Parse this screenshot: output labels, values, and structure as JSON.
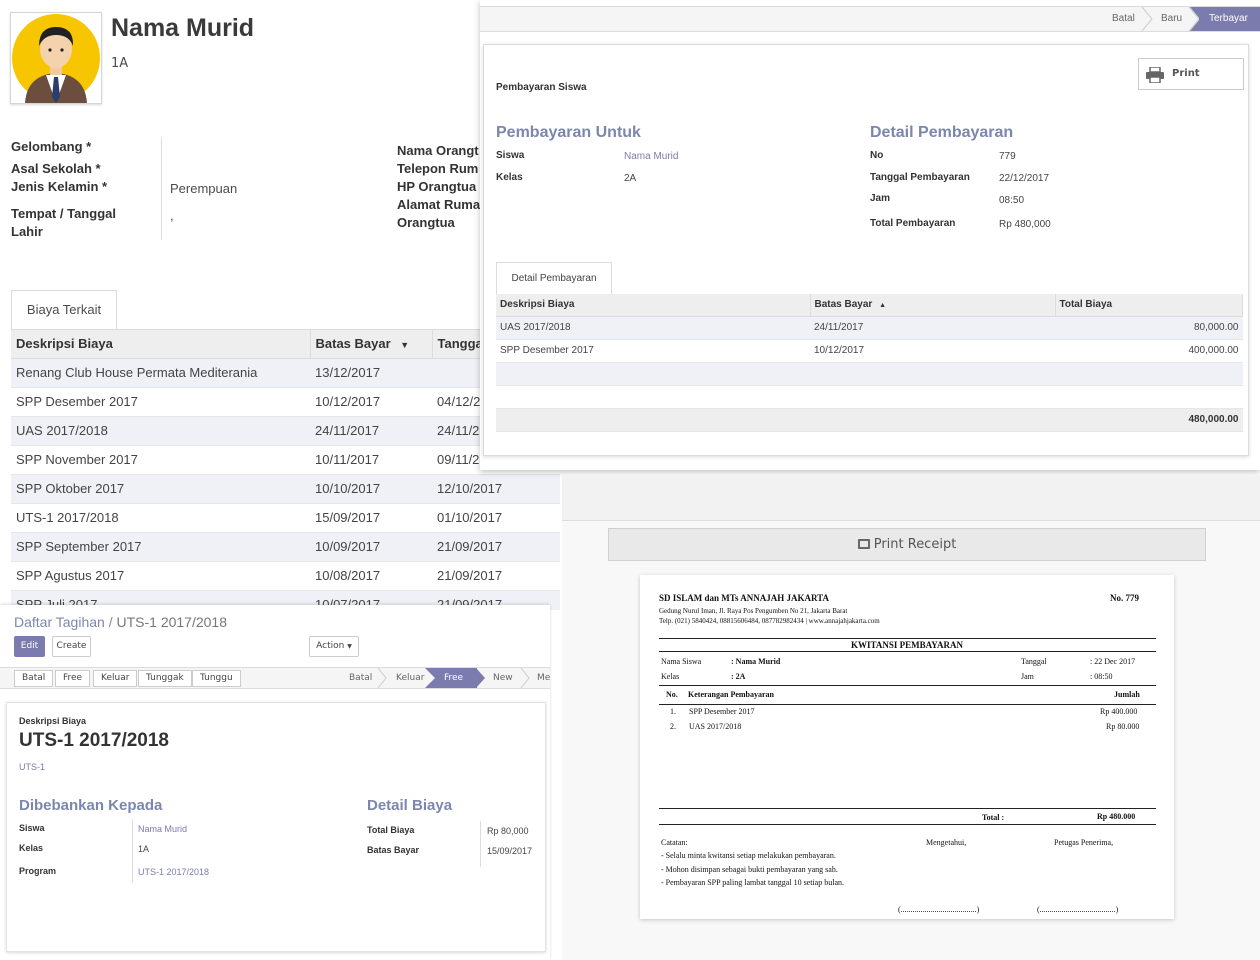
{
  "student": {
    "name": "Nama Murid",
    "class": "1A",
    "fields_left": [
      {
        "label": "Gelombang *",
        "value": ""
      },
      {
        "label": "Asal Sekolah *",
        "value": ""
      },
      {
        "label": "Jenis Kelamin *",
        "value": "Perempuan"
      },
      {
        "label": "Tempat / Tanggal",
        "label2": "Lahir",
        "value": ","
      }
    ],
    "fields_right": [
      "Nama Orangt",
      "Telepon Rum",
      "HP Orangtua",
      "Alamat Ruma",
      "Orangtua"
    ],
    "tab_label": "Biaya Terkait",
    "columns": [
      "Deskripsi Biaya",
      "Batas Bayar",
      "Tangga"
    ],
    "rows": [
      [
        "Renang Club House Permata Mediterania",
        "13/12/2017",
        ""
      ],
      [
        "SPP Desember 2017",
        "10/12/2017",
        "04/12/2"
      ],
      [
        "UAS 2017/2018",
        "24/11/2017",
        "24/11/2"
      ],
      [
        "SPP November 2017",
        "10/11/2017",
        "09/11/2"
      ],
      [
        "SPP Oktober 2017",
        "10/10/2017",
        "12/10/2017"
      ],
      [
        "UTS-1 2017/2018",
        "15/09/2017",
        "01/10/2017"
      ],
      [
        "SPP September 2017",
        "10/09/2017",
        "21/09/2017"
      ],
      [
        "SPP Agustus 2017",
        "10/08/2017",
        "21/09/2017"
      ],
      [
        "SPP Juli 2017",
        "10/07/2017",
        "21/09/2017"
      ]
    ]
  },
  "payment": {
    "status_steps": [
      "Batal",
      "Baru",
      "Terbayar"
    ],
    "current_step": "Terbayar",
    "print_label": "Print",
    "doc_title": "Pembayaran Siswa",
    "left_title": "Pembayaran Untuk",
    "left_fields": [
      {
        "label": "Siswa",
        "value": "Nama Murid"
      },
      {
        "label": "Kelas",
        "value": "2A"
      }
    ],
    "right_title": "Detail Pembayaran",
    "right_fields": [
      {
        "label": "No",
        "value": "779"
      },
      {
        "label": "Tanggal Pembayaran",
        "value": "22/12/2017"
      },
      {
        "label": "Jam",
        "value": "08:50"
      },
      {
        "label": "Total Pembayaran",
        "value": "Rp 480,000"
      }
    ],
    "tab_label": "Detail Pembayaran",
    "columns": [
      "Deskripsi Biaya",
      "Batas Bayar",
      "Total Biaya"
    ],
    "rows": [
      [
        "UAS 2017/2018",
        "24/11/2017",
        "80,000.00"
      ],
      [
        "SPP Desember 2017",
        "10/12/2017",
        "400,000.00"
      ]
    ],
    "total": "480,000.00"
  },
  "tagihan": {
    "breadcrumb_parent": "Daftar Tagihan",
    "breadcrumb_sep": "/",
    "breadcrumb_current": "UTS-1 2017/2018",
    "edit_label": "Edit",
    "create_label": "Create",
    "action_label": "Action",
    "buttons": [
      "Batal",
      "Free",
      "Keluar",
      "Tunggak",
      "Tunggu"
    ],
    "steps": [
      "Batal",
      "Keluar",
      "Free",
      "New",
      "Me"
    ],
    "current_step": "Free",
    "desc_label": "Deskripsi Biaya",
    "title": "UTS-1 2017/2018",
    "code": "UTS-1",
    "left_title": "Dibebankan Kepada",
    "left_fields": [
      {
        "label": "Siswa",
        "value": "Nama Murid"
      },
      {
        "label": "Kelas",
        "value": "1A"
      },
      {
        "label": "Program",
        "value": "UTS-1 2017/2018"
      }
    ],
    "right_title": "Detail Biaya",
    "right_fields": [
      {
        "label": "Total Biaya",
        "value": "Rp 80,000"
      },
      {
        "label": "Batas Bayar",
        "value": "15/09/2017"
      }
    ]
  },
  "receipt": {
    "button_label": "Print Receipt",
    "school": "SD ISLAM dan MTs ANNAJAH JAKARTA",
    "number": "No. 779",
    "address": "Gedung Nurul Iman, Jl. Raya Pos Pengumben No 21, Jakarta Barat",
    "phone": "Telp. (021) 5840424, 08815606484, 087782982434 | www.annajahjakarta.com",
    "heading": "KWITANSI PEMBAYARAN",
    "nama_label": "Nama Siswa",
    "nama_value": ": Nama Murid",
    "kelas_label": "Kelas",
    "kelas_value": ": 2A",
    "tanggal_label": "Tanggal",
    "tanggal_value": ": 22 Dec 2017",
    "jam_label": "Jam",
    "jam_value": ": 08:50",
    "col_no": "No.",
    "col_ket": "Keterangan Pembayaran",
    "col_jumlah": "Jumlah",
    "items": [
      {
        "no": "1.",
        "ket": "SPP Desember 2017",
        "jumlah": "Rp 400.000"
      },
      {
        "no": "2.",
        "ket": "UAS 2017/2018",
        "jumlah": "Rp 80.000"
      }
    ],
    "total_label": "Total :",
    "total_value": "Rp 480.000",
    "catatan_label": "Catatan:",
    "notes": [
      "- Selalu minta kwitansi setiap melakukan pembayaran.",
      "- Mohon disimpan sebagai bukti pembayaran yang sah.",
      "- Pembayaran SPP paling lambat tanggal 10 setiap bulan."
    ],
    "mengetahui": "Mengetahui,",
    "petugas": "Petugas Penerima,",
    "sign1": "(......................................)",
    "sign2": "(......................................)"
  }
}
